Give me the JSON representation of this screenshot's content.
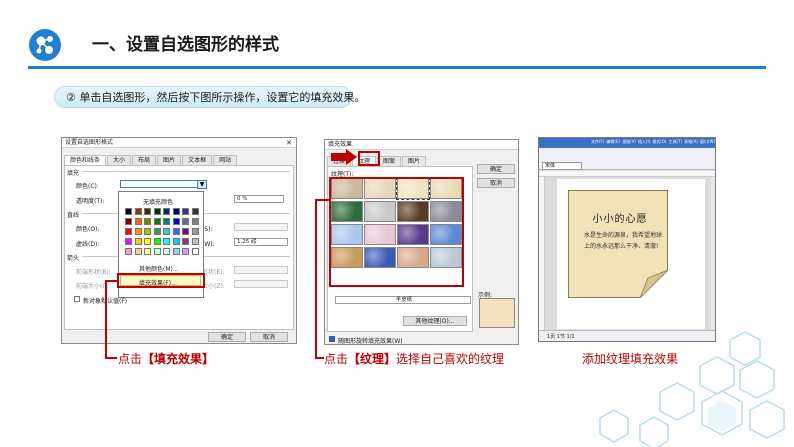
{
  "header": {
    "title": "一、设置自选图形的样式",
    "instruction": "② 单击自选图形，然后按下图所示操作，设置它的填充效果。"
  },
  "colors": {
    "accent": "#1f7fd3",
    "highlight": "#c00000"
  },
  "dialog1": {
    "title": "设置自选图形格式",
    "close": "✕",
    "tabs": [
      "颜色和线条",
      "大小",
      "布局",
      "图片",
      "文本框",
      "网站"
    ],
    "sections": {
      "fill": "填充",
      "line": "直线",
      "arrows": "箭头"
    },
    "fill_color_label": "颜色(C):",
    "transparency_label": "透明度(T):",
    "transparency_value": "0 %",
    "line_color_label": "颜色(O):",
    "dash_label": "虚线(D):",
    "style_label": "线型(S):",
    "weight_label": "粗细(W):",
    "weight_value": "1.25 磅",
    "begin_style_label": "前端形状(B):",
    "end_style_label": "后端形状(E):",
    "begin_size_label": "前端大小(I):",
    "end_size_label": "后端大小(Z):",
    "default_checkbox": "新对象默认值(F)",
    "ok": "确定",
    "cancel": "取消",
    "palette": {
      "no_fill": "无填充颜色",
      "more_colors": "其他颜色(M)...",
      "fill_effects": "填充效果(F)..."
    }
  },
  "dialog2": {
    "title": "填充效果",
    "tabs": [
      "过渡",
      "纹理",
      "图案",
      "图片"
    ],
    "texture_label": "纹理(T):",
    "selected_name": "羊皮纸",
    "other_texture": "其他纹理(O)...",
    "ok": "确定",
    "cancel": "取消",
    "sample": "示例:",
    "rotate_checkbox": "随图形旋转填充效果(W)"
  },
  "word": {
    "menu": [
      "文件(F)",
      "编辑(E)",
      "视图(V)",
      "插入(I)",
      "格式(O)",
      "工具(T)",
      "表格(A)",
      "窗口(W)",
      "帮助(H)"
    ],
    "font": "宋体",
    "doc_title": "小小的心愿",
    "doc_text": "水是生命的源泉，我希望地球上的水永远那么干净、清澈!",
    "statusbar": "1页 1节 1/1"
  },
  "captions": {
    "c1_prefix": "点击",
    "c1_key": "【填充效果】",
    "c2_prefix": "点击",
    "c2_key": "【纹理】",
    "c2_suffix": "选择自己喜欢的纹理",
    "c3": "添加纹理填充效果"
  }
}
